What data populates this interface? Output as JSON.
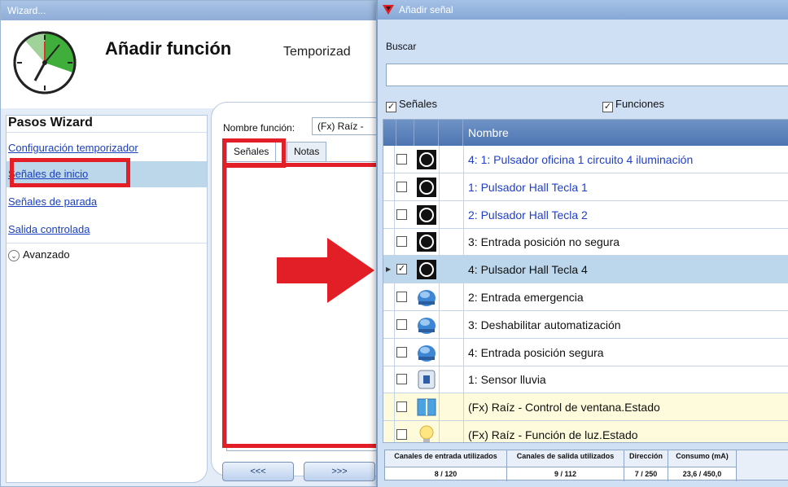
{
  "wizard": {
    "window_title": "Wizard...",
    "title": "Añadir función",
    "subtitle": "Temporizad",
    "steps_heading": "Pasos Wizard",
    "steps": [
      {
        "label": "Configuración temporizador"
      },
      {
        "label": "Señales de inicio"
      },
      {
        "label": "Señales de parada"
      },
      {
        "label": "Salida controlada"
      }
    ],
    "advanced_label": "Avanzado",
    "function_name_label": "Nombre función:",
    "function_name_value": "(Fx) Raíz -",
    "tabs": [
      {
        "label": "Señales"
      },
      {
        "label": "Notas"
      }
    ],
    "prev_button": "<<<",
    "next_button": ">>>"
  },
  "dialog": {
    "window_title": "Añadir señal",
    "search_label": "Buscar",
    "search_value": "",
    "filter_signals": "Señales",
    "filter_functions": "Funciones",
    "column_name": "Nombre",
    "rows": [
      {
        "label": "4: 1: Pulsador oficina 1 circuito 4 iluminación",
        "checked": false,
        "icon": "pushbutton-black-icon",
        "color": "blue"
      },
      {
        "label": "1: Pulsador Hall Tecla 1",
        "checked": false,
        "icon": "pushbutton-black-icon",
        "color": "blue"
      },
      {
        "label": "2: Pulsador Hall Tecla 2",
        "checked": false,
        "icon": "pushbutton-black-icon",
        "color": "blue"
      },
      {
        "label": "3: Entrada posición no segura",
        "checked": false,
        "icon": "pushbutton-black-icon",
        "color": "black"
      },
      {
        "label": "4: Pulsador Hall Tecla 4",
        "checked": true,
        "icon": "pushbutton-black-icon",
        "color": "black"
      },
      {
        "label": "2: Entrada emergencia",
        "checked": false,
        "icon": "dome-blue-icon",
        "color": "black"
      },
      {
        "label": "3: Deshabilitar automatización",
        "checked": false,
        "icon": "dome-blue-icon",
        "color": "black"
      },
      {
        "label": "4: Entrada posición segura",
        "checked": false,
        "icon": "dome-blue-icon",
        "color": "black"
      },
      {
        "label": "1: Sensor lluvia",
        "checked": false,
        "icon": "rain-sensor-icon",
        "color": "black"
      },
      {
        "label": "(Fx) Raíz - Control de ventana.Estado",
        "checked": false,
        "icon": "window-icon",
        "color": "black"
      },
      {
        "label": "(Fx) Raíz - Función de luz.Estado",
        "checked": false,
        "icon": "light-bulb-icon",
        "color": "black"
      }
    ],
    "status": [
      {
        "header": "Canales de entrada utilizados",
        "value": "8 / 120"
      },
      {
        "header": "Canales de salida utilizados",
        "value": "9 / 112"
      },
      {
        "header": "Dirección",
        "value": "7 / 250"
      },
      {
        "header": "Consumo (mA)",
        "value": "23,6 / 450,0"
      }
    ]
  },
  "colors": {
    "annotation_red": "#e21f26",
    "selection_blue": "#bcd7ec",
    "link_blue": "#1f3fc8",
    "header_blue": "#4d75b1"
  }
}
